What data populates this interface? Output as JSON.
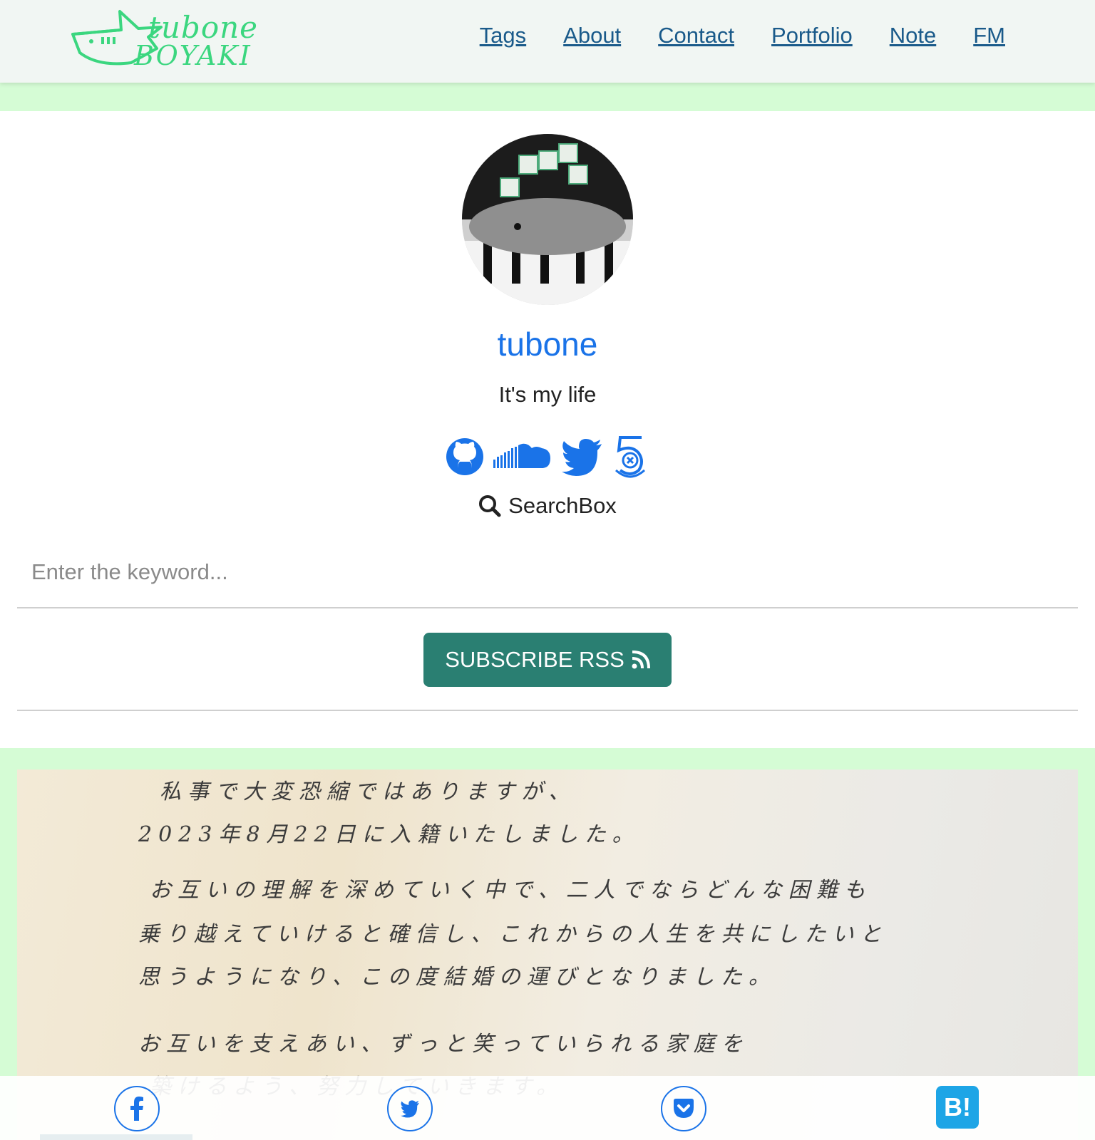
{
  "header": {
    "logo": {
      "line1": "tubone",
      "line2": "BOYAKI"
    },
    "nav": [
      "Tags",
      "About",
      "Contact",
      "Portfolio",
      "Note",
      "FM"
    ]
  },
  "profile": {
    "name": "tubone",
    "tagline": "It's my life",
    "socials": [
      "github-icon",
      "soundcloud-icon",
      "twitter-icon",
      "500px-icon"
    ],
    "search_label": "SearchBox",
    "search_placeholder": "Enter the keyword...",
    "rss_label": "SUBSCRIBE RSS"
  },
  "letter": {
    "lines": [
      "私事で大変恐縮ではありますが、",
      "2023年8月22日に入籍いたしました。",
      "お互いの理解を深めていく中で、二人でならどんな困難も",
      "乗り越えていけると確信し、これからの人生を共にしたいと",
      "思うようになり、この度結婚の運びとなりました。",
      "お互いを支えあい、ずっと笑っていられる家庭を",
      "築けるよう、努力していきます。"
    ]
  },
  "share": [
    "facebook-icon",
    "twitter-icon",
    "pocket-icon",
    "hatena-bookmark-icon"
  ],
  "share_hatena_label": "B!",
  "colors": {
    "accent": "#1a73e8",
    "band": "#d5fcd5",
    "rss": "#2a7f72",
    "logo": "#3bd67f",
    "nav_link": "#1a5a8a",
    "hatena": "#1ea5e6"
  }
}
